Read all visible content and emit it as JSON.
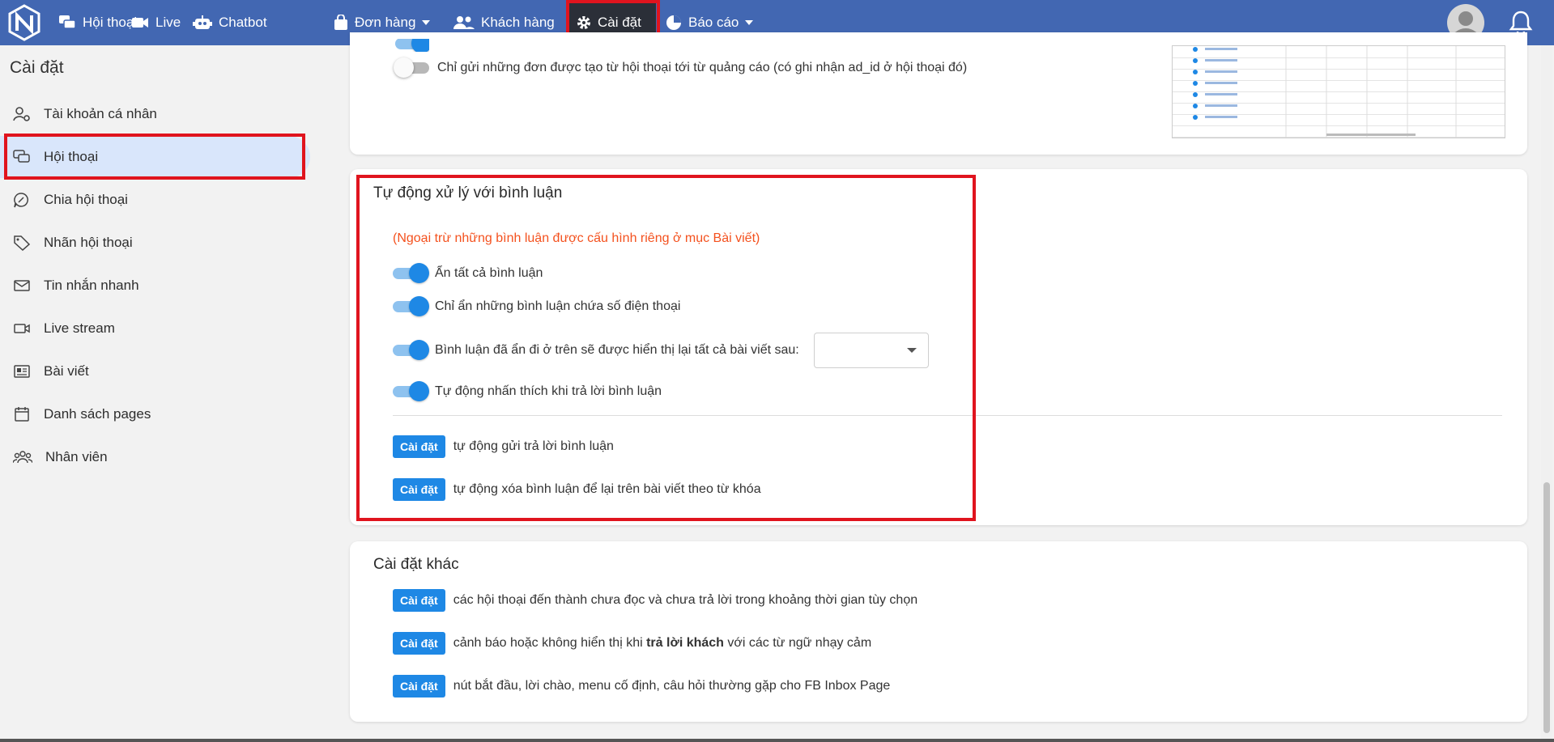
{
  "nav": {
    "items": [
      {
        "label": "Hội thoại",
        "icon": "chat-icon"
      },
      {
        "label": "Live",
        "icon": "video-icon"
      },
      {
        "label": "Chatbot",
        "icon": "robot-icon"
      },
      {
        "label": "Đơn hàng",
        "icon": "bag-icon",
        "dropdown": true
      },
      {
        "label": "Khách hàng",
        "icon": "users-icon"
      },
      {
        "label": "Cài đặt",
        "icon": "gear-icon",
        "active": true
      },
      {
        "label": "Báo cáo",
        "icon": "pie-chart-icon",
        "dropdown": true
      }
    ]
  },
  "sidebar": {
    "title": "Cài đặt",
    "items": [
      {
        "label": "Tài khoản cá nhân",
        "icon": "user-settings-icon"
      },
      {
        "label": "Hội thoại",
        "icon": "chat-icon",
        "active": true
      },
      {
        "label": "Chia hội thoại",
        "icon": "share-chat-icon"
      },
      {
        "label": "Nhãn hội thoại",
        "icon": "tag-icon"
      },
      {
        "label": "Tin nhắn nhanh",
        "icon": "mail-icon"
      },
      {
        "label": "Live stream",
        "icon": "video-icon"
      },
      {
        "label": "Bài viết",
        "icon": "article-icon"
      },
      {
        "label": "Danh sách pages",
        "icon": "calendar-icon"
      },
      {
        "label": "Nhân viên",
        "icon": "staff-icon"
      }
    ]
  },
  "top_card": {
    "toggle_label": "Chỉ gửi những đơn được tạo từ hội thoại tới từ quảng cáo (có ghi nhận ad_id ở hội thoại đó)",
    "toggle_on": false
  },
  "comment_card": {
    "title": "Tự động xử lý với bình luận",
    "note": "(Ngoại trừ những bình luận được cấu hình riêng ở mục Bài viết)",
    "toggles": [
      {
        "label": "Ẩn tất cả bình luận",
        "on": true
      },
      {
        "label": "Chỉ ẩn những bình luận chứa số điện thoại",
        "on": true
      },
      {
        "label": "Bình luận đã ẩn đi ở trên sẽ được hiển thị lại tất cả bài viết sau:",
        "on": true,
        "select_value": ""
      },
      {
        "label": "Tự động nhấn thích khi trả lời bình luận",
        "on": true
      }
    ],
    "actions": [
      {
        "button": "Cài đặt",
        "text": "tự động gửi trả lời bình luận"
      },
      {
        "button": "Cài đặt",
        "text": "tự động xóa bình luận để lại trên bài viết theo từ khóa"
      }
    ]
  },
  "other_card": {
    "title": "Cài đặt khác",
    "actions": [
      {
        "button": "Cài đặt",
        "text": "các hội thoại đến thành chưa đọc và chưa trả lời trong khoảng thời gian tùy chọn"
      },
      {
        "button": "Cài đặt",
        "text_before": "cảnh báo hoặc không hiển thị khi ",
        "text_bold": "trả lời khách",
        "text_after": " với các từ ngữ nhạy cảm"
      },
      {
        "button": "Cài đặt",
        "text": "nút bắt đầu, lời chào, menu cố định, câu hỏi thường gặp cho FB Inbox Page"
      }
    ]
  },
  "colors": {
    "nav": "#4267b2",
    "accent": "#1e88e5",
    "note": "#f4511e",
    "highlight": "#e0141e"
  }
}
